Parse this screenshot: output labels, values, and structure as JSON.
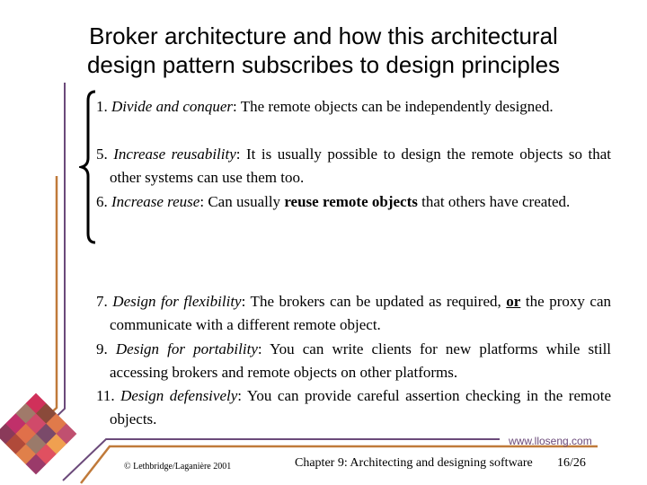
{
  "slide": {
    "title_line1": "Broker architecture and how this architectural",
    "title_line2": "design pattern subscribes to design principles",
    "items": [
      {
        "num": "1.",
        "principle": "Divide and conquer",
        "text": ": The remote objects can be independently designed."
      },
      {
        "num": "5.",
        "principle": "Increase reusability",
        "text": ": It is usually possible to design the remote objects so that other systems can use them too."
      },
      {
        "num": "6.",
        "principle": "Increase reuse",
        "text_before": ": Can usually ",
        "bold": "reuse remote objects",
        "text_after": " that others have created."
      },
      {
        "num": "7.",
        "principle": "Design for flexibility",
        "text_before": ": The brokers can be updated as required, ",
        "bold_underline": "or",
        "text_after": " the proxy can communicate with a different remote object."
      },
      {
        "num": "9.",
        "principle": "Design for portability",
        "text": ": You can write clients for new platforms while still accessing brokers and remote objects on other platforms."
      },
      {
        "num": "11.",
        "principle": "Design defensively",
        "text": ": You can provide careful assertion checking in the remote objects."
      }
    ]
  },
  "footer": {
    "copyright": "© Lethbridge/Laganière 2001",
    "chapter": "Chapter 9: Architecting and designing software",
    "page": "16/26",
    "url": "www.lloseng.com"
  },
  "colors": {
    "purple": "#6b4a7a",
    "orange": "#c07a3a"
  }
}
